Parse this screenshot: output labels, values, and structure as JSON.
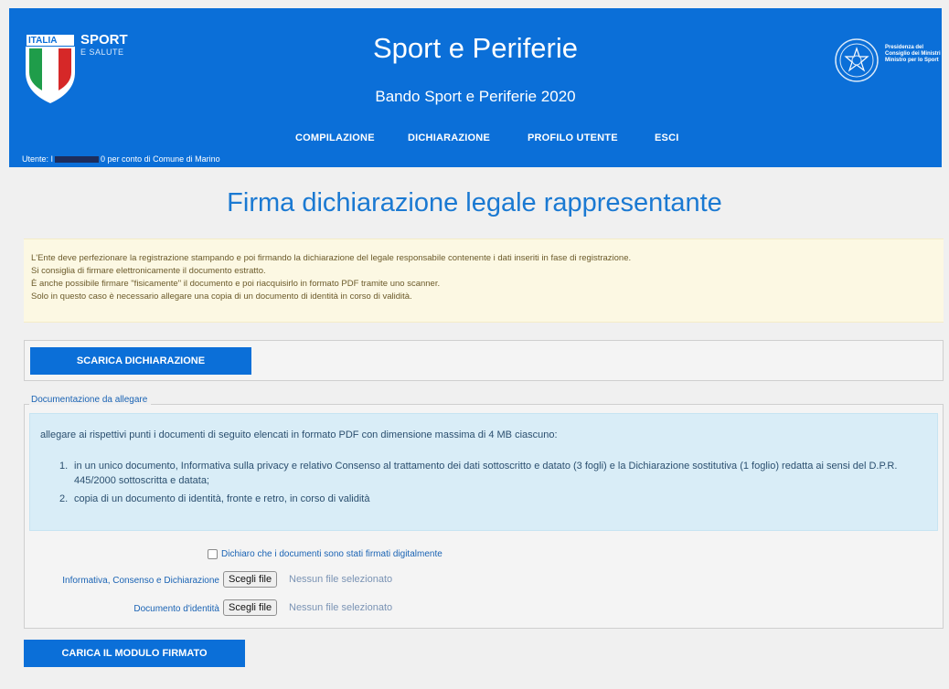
{
  "header": {
    "logo_left": {
      "country": "ITALIA",
      "brand": "SPORT",
      "brand_sub": "E SALUTE"
    },
    "title": "Sport e Periferie",
    "subtitle": "Bando Sport e Periferie 2020",
    "logo_right_text": [
      "Presidenza del",
      "Consiglio dei Ministri",
      "Ministro per lo Sport"
    ],
    "nav": [
      "COMPILAZIONE",
      "DICHIARAZIONE",
      "PROFILO UTENTE",
      "ESCI"
    ],
    "user_prefix": "Utente: ",
    "user_initial": "I",
    "user_suffix": "0 per conto di Comune di Marino"
  },
  "page_title": "Firma dichiarazione legale rappresentante",
  "notice": [
    "L'Ente deve perfezionare la registrazione stampando e poi firmando la dichiarazione del legale responsabile contenente i dati inseriti in fase di registrazione.",
    "Si consiglia di firmare elettronicamente il documento estratto.",
    "È anche possibile firmare \"fisicamente\" il documento e poi riacquisirlo in formato PDF tramite uno scanner.",
    "Solo in questo caso è necessario allegare una copia di un documento di identità in corso di validità."
  ],
  "download_button": "SCARICA DICHIARAZIONE",
  "attachments": {
    "legend": "Documentazione da allegare",
    "intro": "allegare ai rispettivi punti i documenti di seguito elencati in formato PDF con dimensione massima di 4 MB ciascuno:",
    "items": [
      "in un unico documento, Informativa sulla privacy e relativo Consenso al trattamento dei dati sottoscritto e datato (3 fogli) e la Dichiarazione sostitutiva (1 foglio) redatta ai sensi del D.P.R. 445/2000 sottoscritta e datata;",
      "copia di un documento di identità, fronte e retro, in corso di validità"
    ],
    "checkbox_label": "Dichiaro che i documenti sono stati firmati digitalmente",
    "checkbox_checked": false,
    "file_inputs": [
      {
        "label": "Informativa, Consenso e Dichiarazione",
        "button": "Scegli file",
        "status": "Nessun file selezionato"
      },
      {
        "label": "Documento d'identità",
        "button": "Scegli file",
        "status": "Nessun file selezionato"
      }
    ]
  },
  "upload_button": "CARICA IL MODULO FIRMATO",
  "colors": {
    "header_blue": "#0b6fd8",
    "heading_blue": "#1a79d2",
    "notice_bg": "#fcf8e3",
    "info_bg": "#d9edf7"
  }
}
